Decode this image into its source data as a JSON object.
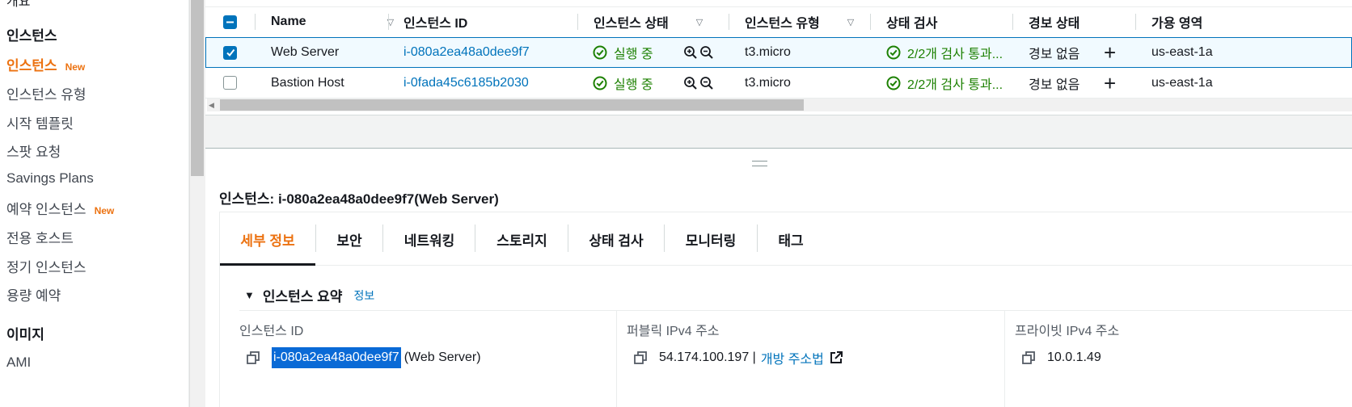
{
  "sidebar": {
    "clipped_top_item": "개요",
    "section_instances": "인스턴스",
    "items": [
      {
        "label": "인스턴스",
        "badge": "New",
        "active": true
      },
      {
        "label": "인스턴스 유형"
      },
      {
        "label": "시작 템플릿"
      },
      {
        "label": "스팟 요청"
      },
      {
        "label": "Savings Plans"
      },
      {
        "label": "예약 인스턴스",
        "badge": "New"
      },
      {
        "label": "전용 호스트"
      },
      {
        "label": "정기 인스턴스"
      },
      {
        "label": "용량 예약"
      }
    ],
    "section_images": "이미지",
    "images_items": [
      {
        "label": "AMI"
      }
    ]
  },
  "table": {
    "columns": [
      "Name",
      "인스턴스 ID",
      "인스턴스 상태",
      "인스턴스 유형",
      "상태 검사",
      "경보 상태",
      "가용 영역"
    ],
    "rows": [
      {
        "selected": true,
        "name": "Web Server",
        "id": "i-080a2ea48a0dee9f7",
        "state": "실행 중",
        "type": "t3.micro",
        "check": "2/2개 검사 통과...",
        "alarm": "경보 없음",
        "az": "us-east-1a"
      },
      {
        "selected": false,
        "name": "Bastion Host",
        "id": "i-0fada45c6185b2030",
        "state": "실행 중",
        "type": "t3.micro",
        "check": "2/2개 검사 통과...",
        "alarm": "경보 없음",
        "az": "us-east-1a"
      }
    ]
  },
  "detail": {
    "title": "인스턴스: i-080a2ea48a0dee9f7(Web Server)",
    "tabs": [
      "세부 정보",
      "보안",
      "네트워킹",
      "스토리지",
      "상태 검사",
      "모니터링",
      "태그"
    ],
    "active_tab": "세부 정보",
    "summary_heading": "인스턴스 요약",
    "summary_info": "정보",
    "fields": {
      "instance_id_label": "인스턴스 ID",
      "instance_id_value": "i-080a2ea48a0dee9f7",
      "instance_id_suffix": "(Web Server)",
      "public_ip_label": "퍼블릭 IPv4 주소",
      "public_ip_value": "54.174.100.197 |",
      "public_ip_link": "개방 주소법",
      "private_ip_label": "프라이빗 IPv4 주소",
      "private_ip_value": "10.0.1.49"
    }
  },
  "colors": {
    "accent_orange": "#ec7211",
    "link_blue": "#0073bb",
    "success_green": "#1d8102",
    "selection_bg": "#f1faff"
  }
}
